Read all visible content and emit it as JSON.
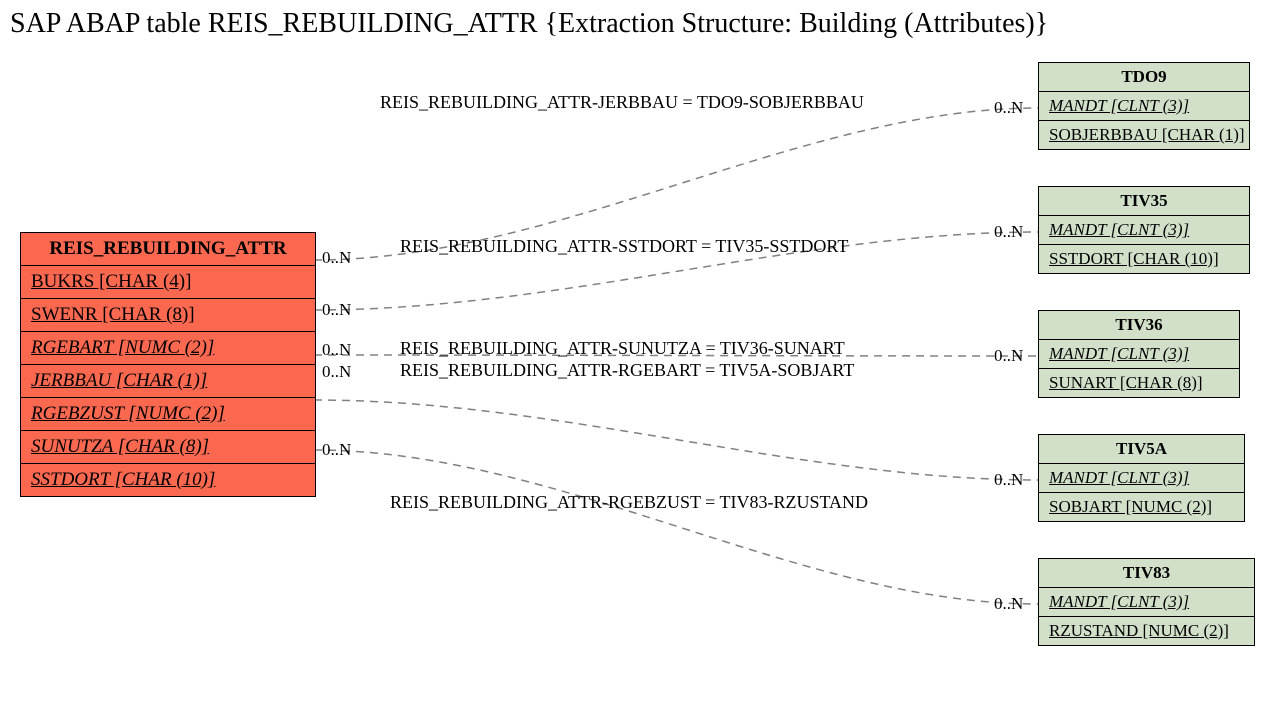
{
  "title": "SAP ABAP table REIS_REBUILDING_ATTR {Extraction Structure: Building (Attributes)}",
  "source": {
    "name": "REIS_REBUILDING_ATTR",
    "fields": [
      {
        "label": "BUKRS [CHAR (4)]",
        "italic": false
      },
      {
        "label": "SWENR [CHAR (8)]",
        "italic": false
      },
      {
        "label": "RGEBART [NUMC (2)]",
        "italic": true
      },
      {
        "label": "JERBBAU [CHAR (1)]",
        "italic": true
      },
      {
        "label": "RGEBZUST [NUMC (2)]",
        "italic": true
      },
      {
        "label": "SUNUTZA [CHAR (8)]",
        "italic": true
      },
      {
        "label": "SSTDORT [CHAR (10)]",
        "italic": true
      }
    ]
  },
  "targets": [
    {
      "name": "TDO9",
      "f1": "MANDT [CLNT (3)]",
      "f2": "SOBJERBBAU [CHAR (1)]"
    },
    {
      "name": "TIV35",
      "f1": "MANDT [CLNT (3)]",
      "f2": "SSTDORT [CHAR (10)]"
    },
    {
      "name": "TIV36",
      "f1": "MANDT [CLNT (3)]",
      "f2": "SUNART [CHAR (8)]"
    },
    {
      "name": "TIV5A",
      "f1": "MANDT [CLNT (3)]",
      "f2": "SOBJART [NUMC (2)]"
    },
    {
      "name": "TIV83",
      "f1": "MANDT [CLNT (3)]",
      "f2": "RZUSTAND [NUMC (2)]"
    }
  ],
  "edges": [
    {
      "label": "REIS_REBUILDING_ATTR-JERBBAU = TDO9-SOBJERBBAU",
      "srcCard": "0..N",
      "dstCard": "0..N"
    },
    {
      "label": "REIS_REBUILDING_ATTR-SSTDORT = TIV35-SSTDORT",
      "srcCard": "0..N",
      "dstCard": "0..N"
    },
    {
      "label": "REIS_REBUILDING_ATTR-SUNUTZA = TIV36-SUNART",
      "srcCard": "0..N",
      "dstCard": "0..N"
    },
    {
      "label": "REIS_REBUILDING_ATTR-RGEBART = TIV5A-SOBJART",
      "srcCard": "0..N",
      "dstCard": "0..N"
    },
    {
      "label": "REIS_REBUILDING_ATTR-RGEBZUST = TIV83-RZUSTAND",
      "srcCard": "0..N",
      "dstCard": "0..N"
    }
  ]
}
